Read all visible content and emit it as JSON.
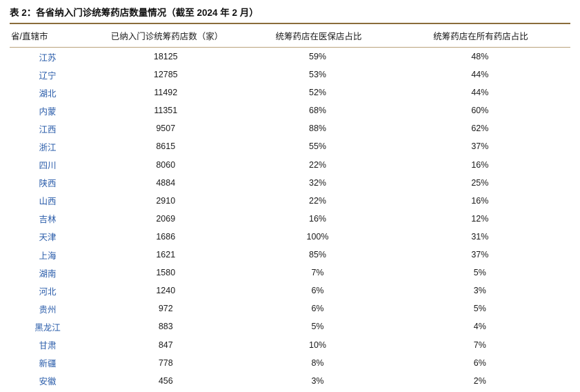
{
  "title": "表 2：各省纳入门诊统筹药店数量情况（截至 2024 年 2 月）",
  "table": {
    "columns": [
      "省/直辖市",
      "已纳入门诊统筹药店数（家）",
      "统筹药店在医保店占比",
      "统筹药店在所有药店占比"
    ],
    "rows": [
      {
        "province": "江苏",
        "count": "18125",
        "ratio_insured": "59%",
        "ratio_all": "48%"
      },
      {
        "province": "辽宁",
        "count": "12785",
        "ratio_insured": "53%",
        "ratio_all": "44%"
      },
      {
        "province": "湖北",
        "count": "11492",
        "ratio_insured": "52%",
        "ratio_all": "44%"
      },
      {
        "province": "内蒙",
        "count": "11351",
        "ratio_insured": "68%",
        "ratio_all": "60%"
      },
      {
        "province": "江西",
        "count": "9507",
        "ratio_insured": "88%",
        "ratio_all": "62%"
      },
      {
        "province": "浙江",
        "count": "8615",
        "ratio_insured": "55%",
        "ratio_all": "37%"
      },
      {
        "province": "四川",
        "count": "8060",
        "ratio_insured": "22%",
        "ratio_all": "16%"
      },
      {
        "province": "陕西",
        "count": "4884",
        "ratio_insured": "32%",
        "ratio_all": "25%"
      },
      {
        "province": "山西",
        "count": "2910",
        "ratio_insured": "22%",
        "ratio_all": "16%"
      },
      {
        "province": "吉林",
        "count": "2069",
        "ratio_insured": "16%",
        "ratio_all": "12%"
      },
      {
        "province": "天津",
        "count": "1686",
        "ratio_insured": "100%",
        "ratio_all": "31%"
      },
      {
        "province": "上海",
        "count": "1621",
        "ratio_insured": "85%",
        "ratio_all": "37%"
      },
      {
        "province": "湖南",
        "count": "1580",
        "ratio_insured": "7%",
        "ratio_all": "5%"
      },
      {
        "province": "河北",
        "count": "1240",
        "ratio_insured": "6%",
        "ratio_all": "3%"
      },
      {
        "province": "贵州",
        "count": "972",
        "ratio_insured": "6%",
        "ratio_all": "5%"
      },
      {
        "province": "黑龙江",
        "count": "883",
        "ratio_insured": "5%",
        "ratio_all": "4%"
      },
      {
        "province": "甘肃",
        "count": "847",
        "ratio_insured": "10%",
        "ratio_all": "7%"
      },
      {
        "province": "新疆",
        "count": "778",
        "ratio_insured": "8%",
        "ratio_all": "6%"
      },
      {
        "province": "安徽",
        "count": "456",
        "ratio_insured": "3%",
        "ratio_all": "2%"
      }
    ]
  }
}
